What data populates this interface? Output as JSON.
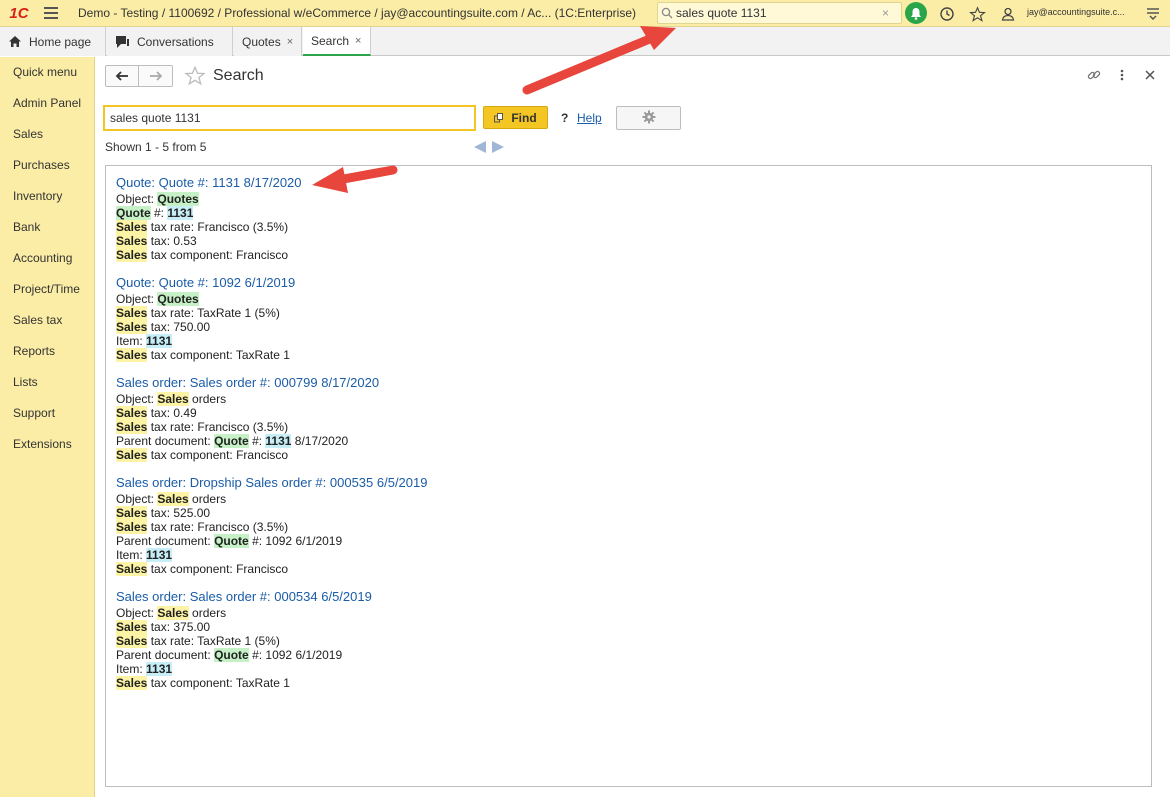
{
  "app": {
    "logo": "1C",
    "title": "Demo - Testing / 1100692 / Professional w/eCommerce / jay@accountingsuite.com / Ac...   (1C:Enterprise)",
    "search_value": "sales quote 1131",
    "search_clear": "×",
    "user_email": "jay@accountingsuite.c..."
  },
  "tabs": [
    {
      "label": "Home page",
      "icon": "home-icon"
    },
    {
      "label": "Conversations",
      "icon": "chat-icon"
    },
    {
      "label": "Quotes",
      "close": "×"
    },
    {
      "label": "Search",
      "close": "×"
    }
  ],
  "sidebar": {
    "items": [
      {
        "label": "Quick menu"
      },
      {
        "label": "Admin Panel"
      },
      {
        "label": "Sales"
      },
      {
        "label": "Purchases"
      },
      {
        "label": "Inventory"
      },
      {
        "label": "Bank"
      },
      {
        "label": "Accounting"
      },
      {
        "label": "Project/Time"
      },
      {
        "label": "Sales tax"
      },
      {
        "label": "Reports"
      },
      {
        "label": "Lists"
      },
      {
        "label": "Support"
      },
      {
        "label": "Extensions"
      }
    ]
  },
  "page": {
    "title": "Search",
    "search_value": "sales quote 1131",
    "find_label": "Find",
    "help_q": "?",
    "help_label": "Help",
    "shown_text": "Shown 1 - 5 from 5"
  },
  "results": [
    {
      "title": "Quote: Quote #: 1131 8/17/2020",
      "lines": [
        {
          "a": "Object: ",
          "h1": "Quotes"
        },
        {
          "h2": "Quote",
          "b": " #: ",
          "h3": "1131"
        },
        {
          "hs": "Sales",
          "a": " tax rate: Francisco (3.5%)"
        },
        {
          "hs": "Sales",
          "a": " tax: 0.53"
        },
        {
          "hs": "Sales",
          "a": " tax component: Francisco"
        }
      ]
    },
    {
      "title": "Quote: Quote #: 1092 6/1/2019",
      "lines": [
        {
          "a": "Object: ",
          "h1": "Quotes"
        },
        {
          "hs": "Sales",
          "a": " tax rate: TaxRate 1 (5%)"
        },
        {
          "hs": "Sales",
          "a": " tax: 750.00"
        },
        {
          "a": "Item: ",
          "h3": "1131"
        },
        {
          "hs": "Sales",
          "a": " tax component: TaxRate 1"
        }
      ]
    },
    {
      "title": "Sales order: Sales order #: 000799 8/17/2020",
      "lines": [
        {
          "a": "Object: ",
          "hs": "Sales",
          "b": " orders"
        },
        {
          "hs": "Sales",
          "a": " tax: 0.49"
        },
        {
          "hs": "Sales",
          "a": " tax rate: Francisco (3.5%)"
        },
        {
          "a": "Parent document: ",
          "h2": "Quote",
          "b": " #: ",
          "h3": "1131",
          "c": " 8/17/2020"
        },
        {
          "hs": "Sales",
          "a": " tax component: Francisco"
        }
      ]
    },
    {
      "title": "Sales order: Dropship Sales order #: 000535 6/5/2019",
      "lines": [
        {
          "a": "Object: ",
          "hs": "Sales",
          "b": " orders"
        },
        {
          "hs": "Sales",
          "a": " tax: 525.00"
        },
        {
          "hs": "Sales",
          "a": " tax rate: Francisco (3.5%)"
        },
        {
          "a": "Parent document: ",
          "h2": "Quote",
          "b": " #: 1092 6/1/2019"
        },
        {
          "a": "Item: ",
          "h3": "1131"
        },
        {
          "hs": "Sales",
          "a": " tax component: Francisco"
        }
      ]
    },
    {
      "title": "Sales order: Sales order #: 000534 6/5/2019",
      "lines": [
        {
          "a": "Object: ",
          "hs": "Sales",
          "b": " orders"
        },
        {
          "hs": "Sales",
          "a": " tax: 375.00"
        },
        {
          "hs": "Sales",
          "a": " tax rate: TaxRate 1 (5%)"
        },
        {
          "a": "Parent document: ",
          "h2": "Quote",
          "b": " #: 1092 6/1/2019"
        },
        {
          "a": "Item: ",
          "h3": "1131"
        },
        {
          "hs": "Sales",
          "a": " tax component: TaxRate 1"
        }
      ]
    }
  ],
  "colors": {
    "accent_yellow": "#f3c623",
    "panel_yellow": "#fbeda6",
    "link_blue": "#1a5ca8",
    "highlight_sales": "#fdf3a4",
    "highlight_quote": "#c6f1c6",
    "highlight_number": "#c7edf7",
    "annotation_red": "#e8453c"
  }
}
